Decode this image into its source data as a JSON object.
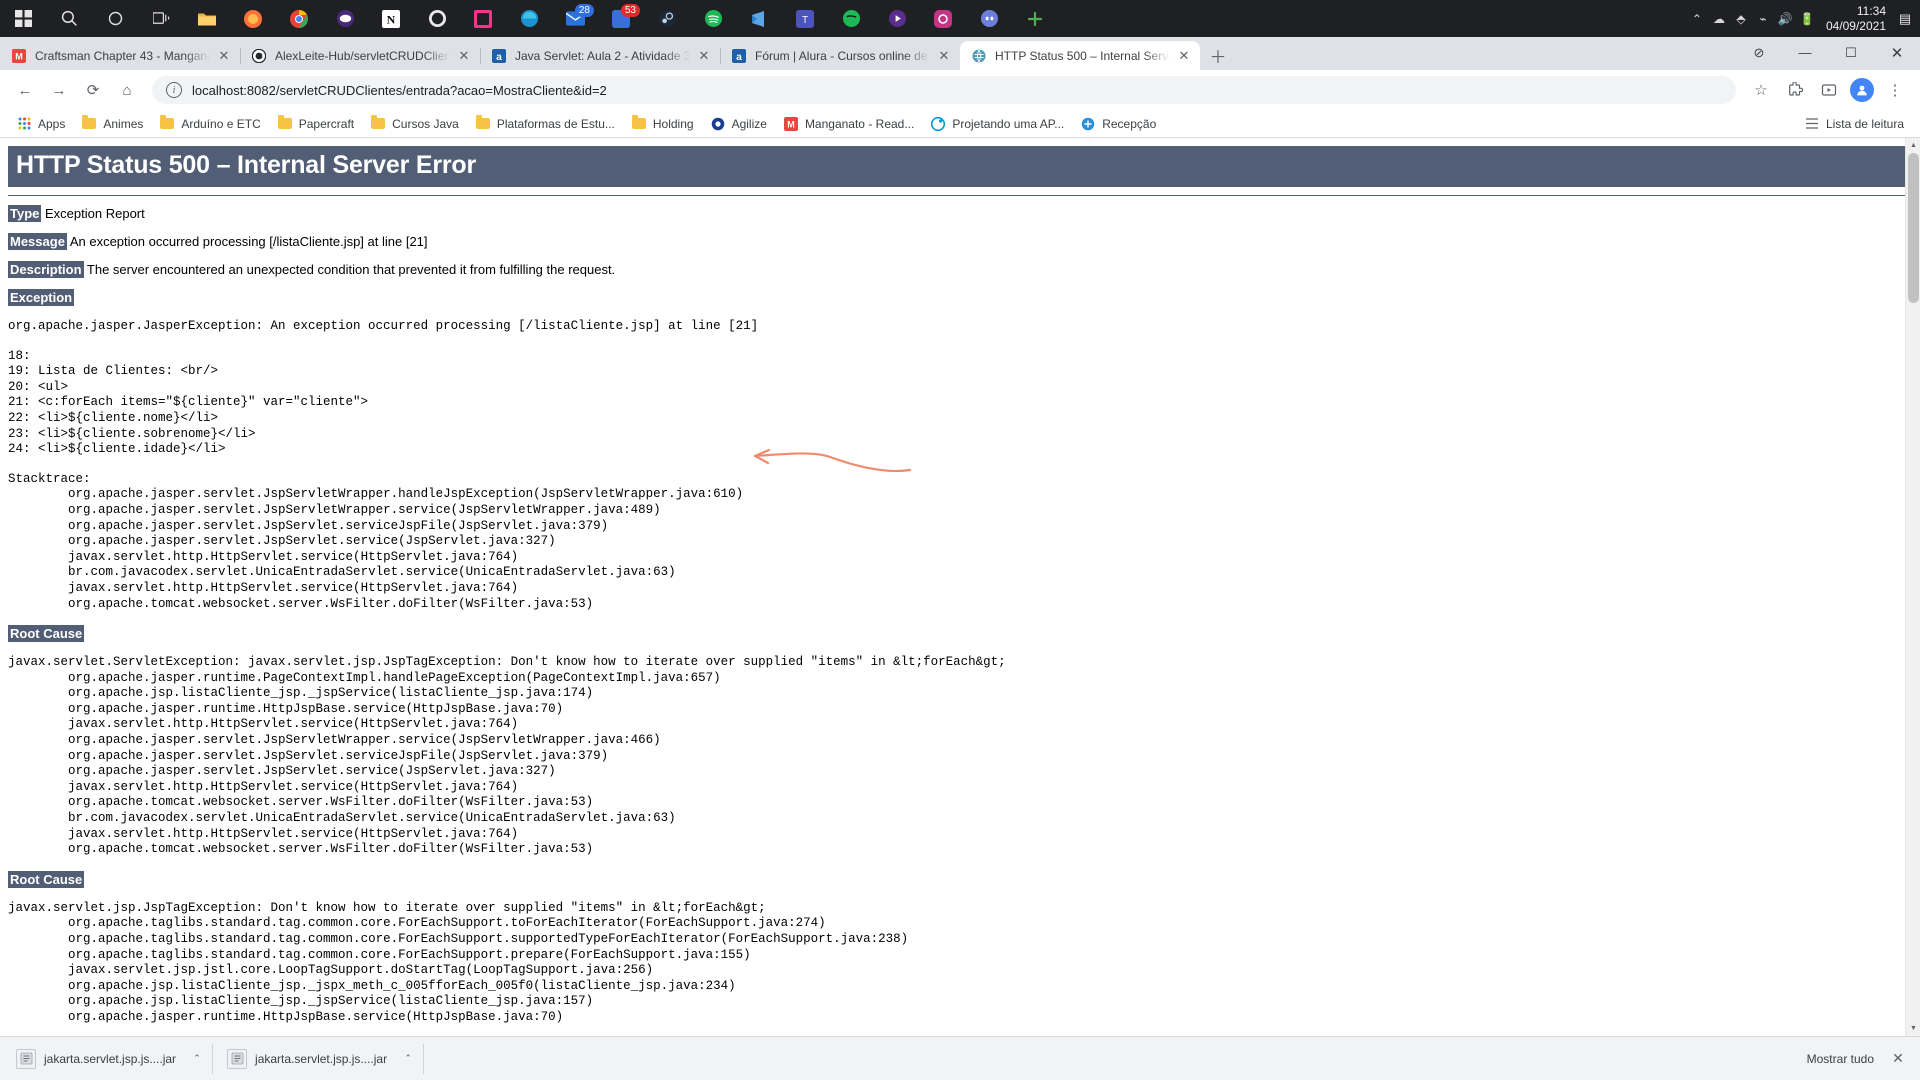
{
  "taskbar": {
    "icons": [
      {
        "name": "start-button",
        "glyph": "⊞"
      },
      {
        "name": "search-icon",
        "glyph": "◯"
      },
      {
        "name": "task-view-icon",
        "glyph": "❒"
      },
      {
        "name": "file-explorer-icon",
        "glyph": "📁"
      },
      {
        "name": "firefox-icon",
        "glyph": "🦊"
      },
      {
        "name": "chrome-icon",
        "glyph": "◉"
      },
      {
        "name": "eclipse-icon",
        "glyph": "⬤"
      },
      {
        "name": "notion-icon",
        "glyph": "N"
      },
      {
        "name": "github-icon",
        "glyph": "◎"
      },
      {
        "name": "intellij-icon",
        "glyph": "◆"
      },
      {
        "name": "edge-icon",
        "glyph": "◠"
      },
      {
        "name": "mail-icon",
        "glyph": "✉",
        "badge": "28"
      },
      {
        "name": "messages-icon",
        "glyph": "▣",
        "badge": "53"
      },
      {
        "name": "steam-icon",
        "glyph": "◍"
      },
      {
        "name": "spotify-green-icon",
        "glyph": "◉"
      },
      {
        "name": "vscode-icon",
        "glyph": "◣"
      },
      {
        "name": "teams-icon",
        "glyph": "▤"
      },
      {
        "name": "spotify-icon",
        "glyph": "♫"
      },
      {
        "name": "video-icon",
        "glyph": "▶"
      },
      {
        "name": "instagram-icon",
        "glyph": "◙"
      },
      {
        "name": "discord-icon",
        "glyph": "◐"
      },
      {
        "name": "add-icon",
        "glyph": "✚"
      }
    ],
    "tray": [
      "∧",
      "☁",
      "⌨",
      "📶",
      "🔊",
      "🔋"
    ],
    "time": "11:34",
    "date": "04/09/2021",
    "notification_glyph": "▤"
  },
  "tabs": [
    {
      "title": "Craftsman Chapter 43 - Mangane",
      "favicon": "M",
      "favicon_color": "#e8453c",
      "active": false
    },
    {
      "title": "AlexLeite-Hub/servletCRUDClien",
      "favicon": "G",
      "favicon_color": "#24292e",
      "active": false
    },
    {
      "title": "Java Servlet: Aula 2 - Atividade 3",
      "favicon": "a",
      "favicon_color": "#1e5fa8",
      "active": false
    },
    {
      "title": "Fórum | Alura - Cursos online de",
      "favicon": "a",
      "favicon_color": "#1e5fa8",
      "active": false
    },
    {
      "title": "HTTP Status 500 – Internal Serve",
      "favicon": "◍",
      "favicon_color": "#5b6770",
      "active": true
    }
  ],
  "tab_controls": {
    "close_glyph": "✕",
    "new_tab_glyph": "＋"
  },
  "window_controls": {
    "extension_glyph": "⊘",
    "minimize": "—",
    "maximize": "☐",
    "close": "✕"
  },
  "toolbar": {
    "back": "←",
    "forward": "→",
    "reload": "⟳",
    "home": "⌂",
    "info_glyph": "i",
    "url": "localhost:8082/servletCRUDClientes/entrada?acao=MostraCliente&id=2",
    "star": "☆",
    "extensions": "🧩",
    "media": "▤",
    "menu": "⋮"
  },
  "bookmarks": {
    "items": [
      {
        "label": "Apps",
        "icon": "apps-grid-icon"
      },
      {
        "label": "Animes",
        "icon": "folder-icon"
      },
      {
        "label": "Arduíno e ETC",
        "icon": "folder-icon"
      },
      {
        "label": "Papercraft",
        "icon": "folder-icon"
      },
      {
        "label": "Cursos Java",
        "icon": "folder-icon"
      },
      {
        "label": "Plataformas de Estu...",
        "icon": "folder-icon"
      },
      {
        "label": "Holding",
        "icon": "folder-icon"
      },
      {
        "label": "Agilize",
        "icon": "agilize-icon"
      },
      {
        "label": "Manganato - Read...",
        "icon": "manganato-icon"
      },
      {
        "label": "Projetando uma AP...",
        "icon": "alura-icon"
      },
      {
        "label": "Recepção",
        "icon": "recepcao-icon"
      }
    ],
    "reading_list": "Lista de leitura",
    "reading_list_icon": "list-icon"
  },
  "error_page": {
    "status_title": "HTTP Status 500 – Internal Server Error",
    "type_label": "Type",
    "type_value": "Exception Report",
    "message_label": "Message",
    "message_value": "An exception occurred processing [/listaCliente.jsp] at line [21]",
    "description_label": "Description",
    "description_value": "The server encountered an unexpected condition that prevented it from fulfilling the request.",
    "exception_label": "Exception",
    "exception_text": "org.apache.jasper.JasperException: An exception occurred processing [/listaCliente.jsp] at line [21]",
    "jsp_source": "18: \n19: Lista de Clientes: <br/>\n20: <ul>\n21: <c:forEach items=\"${cliente}\" var=\"cliente\">\n22: <li>${cliente.nome}</li>\n23: <li>${cliente.sobrenome}</li>\n24: <li>${cliente.idade}</li>",
    "stacktrace_label": "Stacktrace:",
    "stacktrace": "\torg.apache.jasper.servlet.JspServletWrapper.handleJspException(JspServletWrapper.java:610)\n\torg.apache.jasper.servlet.JspServletWrapper.service(JspServletWrapper.java:489)\n\torg.apache.jasper.servlet.JspServlet.serviceJspFile(JspServlet.java:379)\n\torg.apache.jasper.servlet.JspServlet.service(JspServlet.java:327)\n\tjavax.servlet.http.HttpServlet.service(HttpServlet.java:764)\n\tbr.com.javacodex.servlet.UnicaEntradaServlet.service(UnicaEntradaServlet.java:63)\n\tjavax.servlet.http.HttpServlet.service(HttpServlet.java:764)\n\torg.apache.tomcat.websocket.server.WsFilter.doFilter(WsFilter.java:53)",
    "root_cause_label_1": "Root Cause",
    "root_cause_1": "javax.servlet.ServletException: javax.servlet.jsp.JspTagException: Don't know how to iterate over supplied \"items\" in &lt;forEach&gt;\n\torg.apache.jasper.runtime.PageContextImpl.handlePageException(PageContextImpl.java:657)\n\torg.apache.jsp.listaCliente_jsp._jspService(listaCliente_jsp.java:174)\n\torg.apache.jasper.runtime.HttpJspBase.service(HttpJspBase.java:70)\n\tjavax.servlet.http.HttpServlet.service(HttpServlet.java:764)\n\torg.apache.jasper.servlet.JspServletWrapper.service(JspServletWrapper.java:466)\n\torg.apache.jasper.servlet.JspServlet.serviceJspFile(JspServlet.java:379)\n\torg.apache.jasper.servlet.JspServlet.service(JspServlet.java:327)\n\tjavax.servlet.http.HttpServlet.service(HttpServlet.java:764)\n\torg.apache.tomcat.websocket.server.WsFilter.doFilter(WsFilter.java:53)\n\tbr.com.javacodex.servlet.UnicaEntradaServlet.service(UnicaEntradaServlet.java:63)\n\tjavax.servlet.http.HttpServlet.service(HttpServlet.java:764)\n\torg.apache.tomcat.websocket.server.WsFilter.doFilter(WsFilter.java:53)",
    "root_cause_label_2": "Root Cause",
    "root_cause_2": "javax.servlet.jsp.JspTagException: Don't know how to iterate over supplied \"items\" in &lt;forEach&gt;\n\torg.apache.taglibs.standard.tag.common.core.ForEachSupport.toForEachIterator(ForEachSupport.java:274)\n\torg.apache.taglibs.standard.tag.common.core.ForEachSupport.supportedTypeForEachIterator(ForEachSupport.java:238)\n\torg.apache.taglibs.standard.tag.common.core.ForEachSupport.prepare(ForEachSupport.java:155)\n\tjavax.servlet.jsp.jstl.core.LoopTagSupport.doStartTag(LoopTagSupport.java:256)\n\torg.apache.jsp.listaCliente_jsp._jspx_meth_c_005fforEach_005f0(listaCliente_jsp.java:234)\n\torg.apache.jsp.listaCliente_jsp._jspService(listaCliente_jsp.java:157)\n\torg.apache.jasper.runtime.HttpJspBase.service(HttpJspBase.java:70)",
    "annotation_color": "#f08a6c"
  },
  "download_shelf": {
    "items": [
      {
        "name": "jakarta.servlet.jsp.js....jar",
        "caret": "⌃"
      },
      {
        "name": "jakarta.servlet.jsp.js....jar",
        "caret": "⌃"
      }
    ],
    "show_all_label": "Mostrar tudo",
    "close_glyph": "✕"
  },
  "scrollbar": {
    "up_arrow": "▲",
    "down_arrow": "▼"
  },
  "colors": {
    "banner": "#525D76",
    "taskbar": "#1f2023",
    "tabstrip": "#dee1e6",
    "annotation": "#f08a6c"
  }
}
